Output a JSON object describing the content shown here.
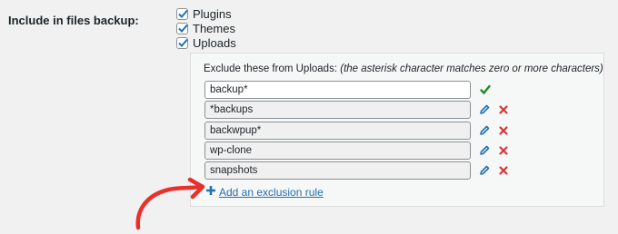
{
  "setting_label": "Include in files backup:",
  "include_options": [
    {
      "label": "Plugins",
      "checked": true
    },
    {
      "label": "Themes",
      "checked": true
    },
    {
      "label": "Uploads",
      "checked": true
    }
  ],
  "exclusions": {
    "heading": "Exclude these from Uploads:",
    "note": "(the asterisk character matches zero or more characters)",
    "rules": [
      {
        "value": "backup*",
        "editing": true
      },
      {
        "value": "*backups",
        "editing": false
      },
      {
        "value": "backwpup*",
        "editing": false
      },
      {
        "value": "wp-clone",
        "editing": false
      },
      {
        "value": "snapshots",
        "editing": false
      }
    ],
    "add_label": "Add an exclusion rule"
  },
  "colors": {
    "link": "#2271b1",
    "confirm": "#1e8a2c",
    "delete": "#d63638",
    "annotation_arrow": "#e8312b"
  },
  "icons": {
    "confirm": "checkmark-icon",
    "edit": "pencil-icon",
    "delete": "x-icon",
    "add": "plus-icon"
  }
}
